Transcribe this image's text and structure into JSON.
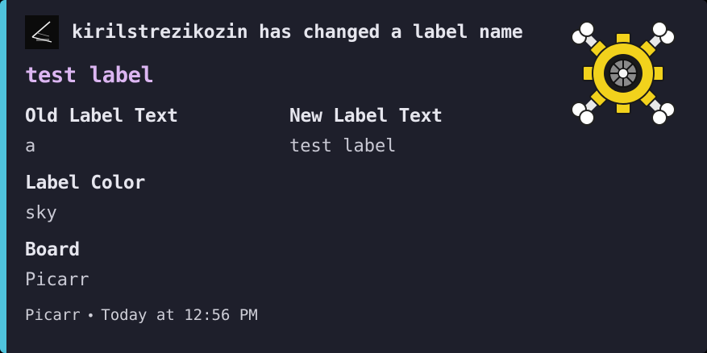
{
  "embed": {
    "accent_color": "#4fc3dc",
    "author": {
      "name_line": "kirilstrezikozin has changed a label name",
      "avatar_icon": "kubectl-avatar-icon"
    },
    "title": "test label",
    "fields": [
      {
        "name": "Old Label Text",
        "value": "a"
      },
      {
        "name": "New Label Text",
        "value": "test label"
      },
      {
        "name": "Label Color",
        "value": "sky"
      },
      {
        "name": "Board",
        "value": "Picarr"
      }
    ],
    "footer": {
      "source": "Picarr",
      "separator": "•",
      "timestamp": "Today at 12:56 PM"
    },
    "thumbnail_icon": "skull-gear-icon"
  }
}
